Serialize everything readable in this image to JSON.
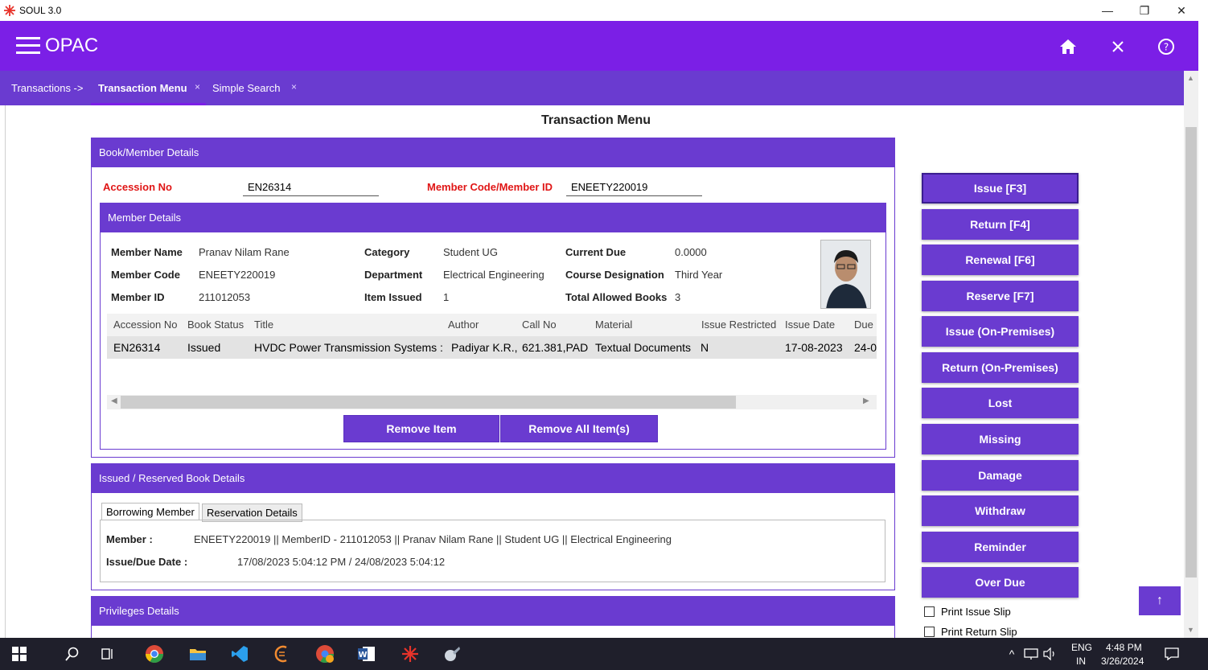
{
  "window": {
    "title": "SOUL 3.0",
    "minimize": "—",
    "maximize": "❐",
    "close": "✕"
  },
  "header": {
    "title": "OPAC"
  },
  "breadcrumb": {
    "root": "Transactions ->",
    "tabs": [
      {
        "label": "Transaction Menu",
        "close": "×"
      },
      {
        "label": "Simple Search",
        "close": "×"
      }
    ]
  },
  "page": {
    "title": "Transaction Menu"
  },
  "book_member_panel": {
    "title": "Book/Member Details",
    "accession_label": "Accession No",
    "accession_value": "EN26314",
    "member_code_label": "Member Code/Member ID",
    "member_code_value": "ENEETY220019"
  },
  "member_details": {
    "title": "Member Details",
    "fields": {
      "member_name_label": "Member Name",
      "member_name": "Pranav Nilam Rane",
      "member_code_label": "Member Code",
      "member_code": "ENEETY220019",
      "member_id_label": "Member ID",
      "member_id": "211012053",
      "category_label": "Category",
      "category": "Student UG",
      "department_label": "Department",
      "department": "Electrical Engineering",
      "item_issued_label": "Item Issued",
      "item_issued": "1",
      "current_due_label": "Current Due",
      "current_due": "0.0000",
      "course_label": "Course Designation",
      "course": "Third Year",
      "total_allowed_label": "Total Allowed Books",
      "total_allowed": "3"
    },
    "table": {
      "columns": [
        "Accession No",
        "Book Status",
        "Title",
        "Author",
        "Call No",
        "Material",
        "Issue Restricted",
        "Issue Date",
        "Due"
      ],
      "rows": [
        [
          "EN26314",
          "Issued",
          "HVDC Power Transmission Systems :",
          "Padiyar K.R.,",
          "621.381,PAD",
          "Textual Documents",
          "N",
          "17-08-2023",
          "24-0"
        ]
      ]
    },
    "remove_item": "Remove Item",
    "remove_all": "Remove All Item(s)"
  },
  "issued_panel": {
    "title": "Issued / Reserved Book Details",
    "tabs": [
      "Borrowing Member",
      "Reservation Details"
    ],
    "member_label": "Member :",
    "member_value": "ENEETY220019 || MemberID - 211012053 || Pranav Nilam Rane || Student UG || Electrical Engineering",
    "date_label": "Issue/Due Date :",
    "date_value": "17/08/2023 5:04:12 PM / 24/08/2023 5:04:12"
  },
  "privileges_panel": {
    "title": "Privileges Details"
  },
  "side_buttons": [
    "Issue [F3]",
    "Return [F4]",
    "Renewal [F6]",
    "Reserve [F7]",
    "Issue (On-Premises)",
    "Return (On-Premises)",
    "Lost",
    "Missing",
    "Damage",
    "Withdraw",
    "Reminder",
    "Over Due"
  ],
  "checkboxes": [
    "Print Issue Slip",
    "Print Return Slip"
  ],
  "taskbar": {
    "lang_top": "ENG",
    "lang_bottom": "IN",
    "time": "4:48 PM",
    "date": "3/26/2024"
  },
  "colors": {
    "header": "#7b1fe6",
    "panel": "#6a3bd0",
    "label_red": "#e01616"
  }
}
